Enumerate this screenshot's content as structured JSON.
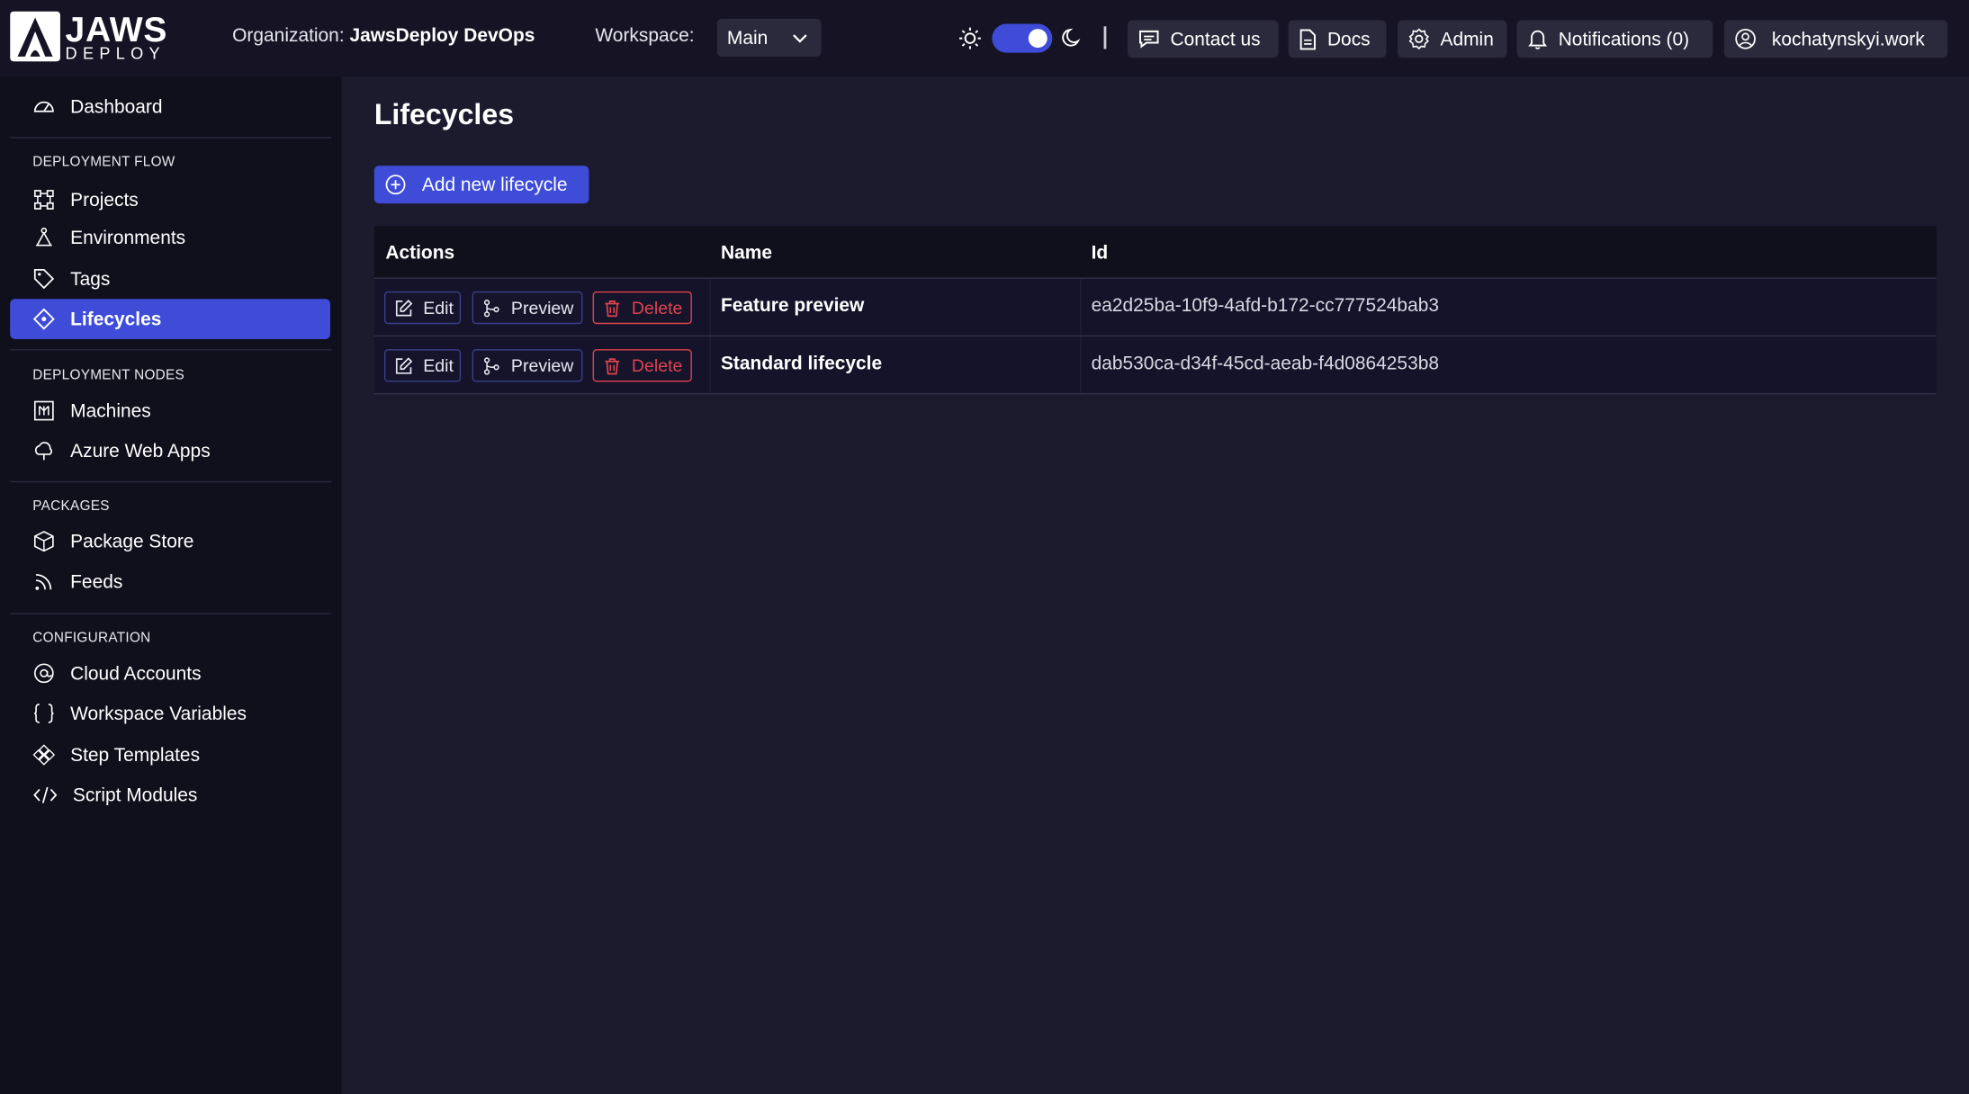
{
  "header": {
    "logo_main": "JAWS",
    "logo_sub": "DEPLOY",
    "org_label": "Organization:",
    "org_name": "JawsDeploy DevOps",
    "workspace_label": "Workspace:",
    "workspace_value": "Main",
    "theme_toggle_on": true,
    "buttons": {
      "contact": "Contact us",
      "docs": "Docs",
      "admin": "Admin",
      "notifications": "Notifications (0)",
      "user": "kochatynskyi.work"
    }
  },
  "sidebar": {
    "dashboard": "Dashboard",
    "sections": {
      "flow": "DEPLOYMENT FLOW",
      "nodes": "DEPLOYMENT NODES",
      "packages": "PACKAGES",
      "config": "CONFIGURATION"
    },
    "items": {
      "projects": "Projects",
      "environments": "Environments",
      "tags": "Tags",
      "lifecycles": "Lifecycles",
      "machines": "Machines",
      "azure": "Azure Web Apps",
      "package_store": "Package Store",
      "feeds": "Feeds",
      "cloud_accounts": "Cloud Accounts",
      "workspace_vars": "Workspace Variables",
      "step_templates": "Step Templates",
      "script_modules": "Script Modules"
    }
  },
  "main": {
    "title": "Lifecycles",
    "add_button": "Add new lifecycle",
    "columns": {
      "actions": "Actions",
      "name": "Name",
      "id": "Id"
    },
    "action_labels": {
      "edit": "Edit",
      "preview": "Preview",
      "delete": "Delete"
    },
    "rows": [
      {
        "name": "Feature preview",
        "id": "ea2d25ba-10f9-4afd-b172-cc777524bab3"
      },
      {
        "name": "Standard lifecycle",
        "id": "dab530ca-d34f-45cd-aeab-f4d0864253b8"
      }
    ]
  },
  "colors": {
    "accent": "#3e4cd8",
    "danger": "#e0434f",
    "background": "#1c1b2e",
    "sidebar": "#100f1c"
  }
}
